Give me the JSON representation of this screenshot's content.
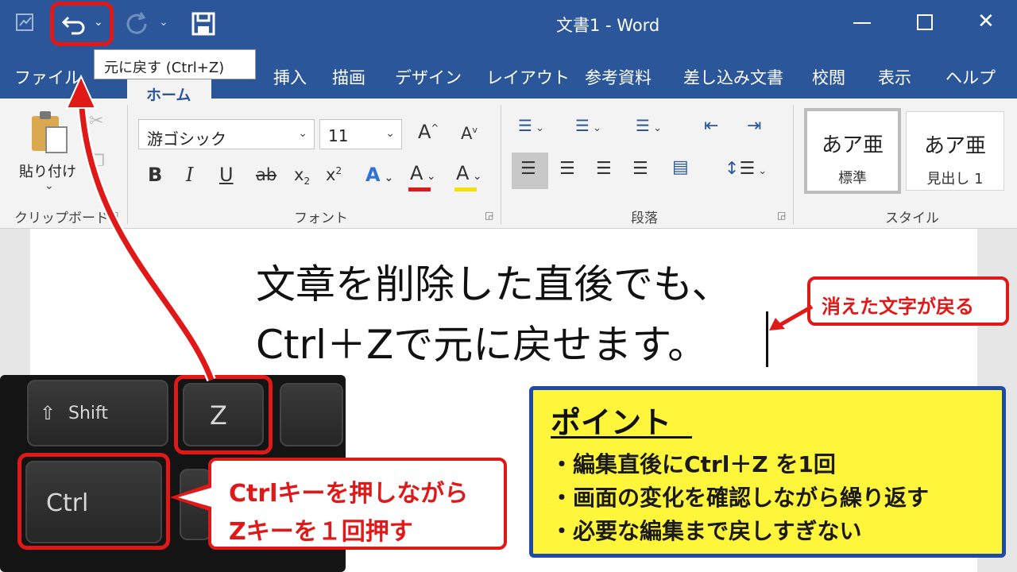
{
  "window": {
    "title": "文書1 - Word",
    "tooltip": "元に戻す (Ctrl+Z)"
  },
  "tabs": [
    "ファイル",
    "ホーム",
    "挿入",
    "描画",
    "デザイン",
    "レイアウト",
    "参考資料",
    "差し込み文書",
    "校閲",
    "表示",
    "ヘルプ"
  ],
  "ribbon": {
    "clipboard": {
      "paste_label": "貼り付け",
      "group_label": "クリップボード"
    },
    "font": {
      "font_name": "游ゴシック",
      "font_size": "11",
      "group_label": "フォント"
    },
    "paragraph": {
      "group_label": "段落"
    },
    "styles": {
      "group_label": "スタイル",
      "items": [
        {
          "preview": "あア亜",
          "name": "標準"
        },
        {
          "preview": "あア亜",
          "name": "見出し 1"
        }
      ]
    }
  },
  "document": {
    "line1": "文章を削除した直後でも、",
    "line2": "Ctrl＋Zで元に戻せます。"
  },
  "annotations": {
    "restored_callout": "消えた文字が戻る",
    "key_callout_line1": "Ctrlキーを押しながら",
    "key_callout_line2": "Zキーを１回押す"
  },
  "keyboard": {
    "shift_label": "Shift",
    "z_label": "Z",
    "ctrl_label": "Ctrl"
  },
  "point": {
    "title": "ポイント",
    "items": [
      "・編集直後にCtrl＋Z を1回",
      "・画面の変化を確認しながら繰り返す",
      "・必要な編集まで戻しすぎない"
    ]
  },
  "colors": {
    "word_blue": "#2b579a",
    "highlight_red": "#e01818",
    "point_yellow": "#fff53a",
    "point_border": "#1f4aa8"
  }
}
